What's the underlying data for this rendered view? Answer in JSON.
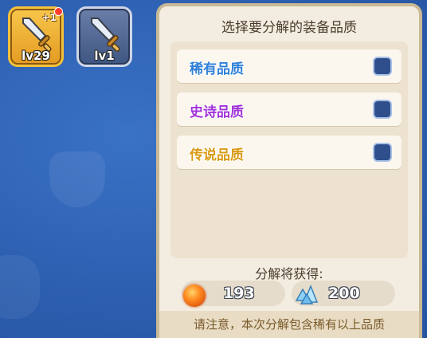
{
  "slots": [
    {
      "level": "lv29",
      "plus": "+1",
      "selected": true,
      "has_dot": true
    },
    {
      "level": "lv1",
      "selected": false
    }
  ],
  "panel": {
    "title": "选择要分解的装备品质",
    "qualities": [
      {
        "label": "稀有品质",
        "color": "#2f7fd6",
        "checked": false
      },
      {
        "label": "史诗品质",
        "color": "#a032d8",
        "checked": false
      },
      {
        "label": "传说品质",
        "color": "#d99a12",
        "checked": false
      }
    ],
    "gain_label": "分解将获得:",
    "rewards": [
      {
        "icon": "fire-orb-icon",
        "value": "193"
      },
      {
        "icon": "crystal-icon",
        "value": "200"
      }
    ],
    "notice": "请注意，本次分解包含稀有以上品质"
  }
}
